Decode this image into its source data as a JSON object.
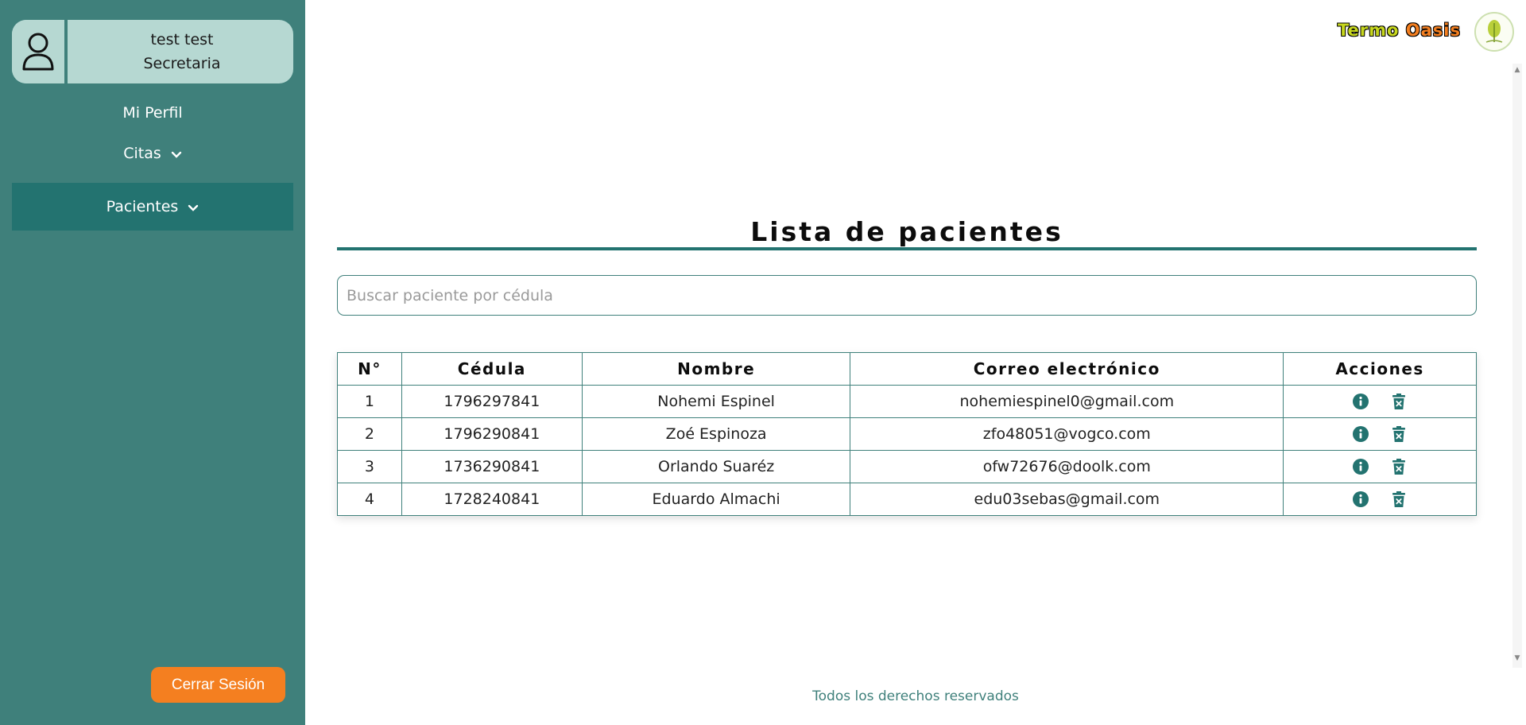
{
  "sidebar": {
    "user": {
      "name": "test test",
      "role": "Secretaria"
    },
    "nav": {
      "profile": "Mi Perfil",
      "citas": "Citas",
      "pacientes": "Pacientes"
    },
    "logout_label": "Cerrar Sesión"
  },
  "brand": {
    "word1": "Termo",
    "word2": "Oasis"
  },
  "main": {
    "title": "Lista de pacientes",
    "search_placeholder": "Buscar paciente por cédula",
    "table": {
      "headers": [
        "N°",
        "Cédula",
        "Nombre",
        "Correo electrónico",
        "Acciones"
      ],
      "rows": [
        {
          "n": "1",
          "cedula": "1796297841",
          "nombre": "Nohemi Espinel",
          "correo": "nohemiespinel0@gmail.com"
        },
        {
          "n": "2",
          "cedula": "1796290841",
          "nombre": "Zoé Espinoza",
          "correo": "zfo48051@vogco.com"
        },
        {
          "n": "3",
          "cedula": "1736290841",
          "nombre": "Orlando Suaréz",
          "correo": "ofw72676@doolk.com"
        },
        {
          "n": "4",
          "cedula": "1728240841",
          "nombre": "Eduardo Almachi",
          "correo": "edu03sebas@gmail.com"
        }
      ]
    }
  },
  "footer": "Todos los derechos reservados",
  "colors": {
    "sidebar": "#3f807b",
    "sidebar_active": "#237370",
    "user_card": "#b6d8d2",
    "accent": "#f47f20",
    "table_border": "#3f807b"
  }
}
